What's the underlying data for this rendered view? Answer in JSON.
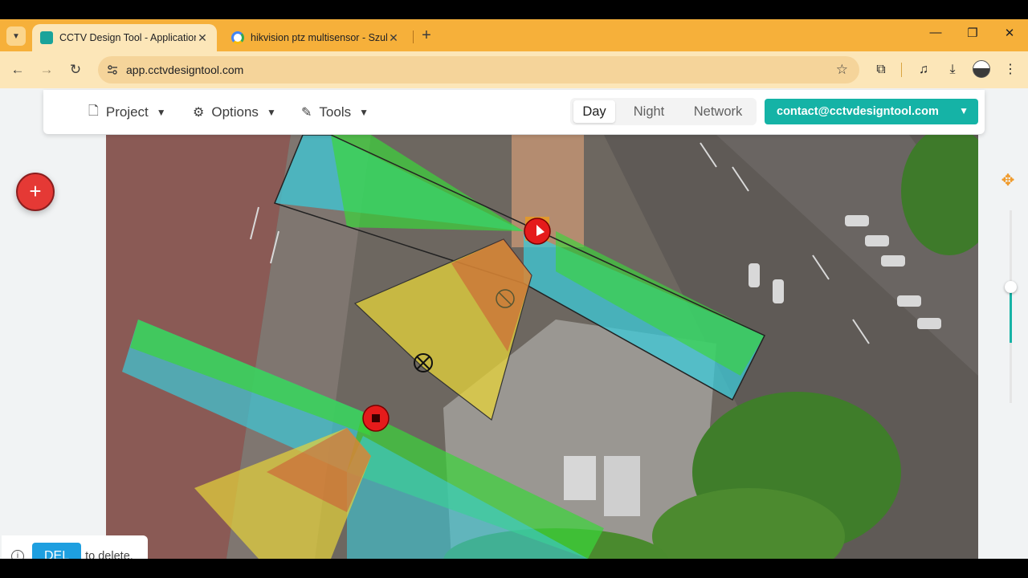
{
  "browser": {
    "tabs": [
      {
        "title": "CCTV Design Tool - Application",
        "active": true
      },
      {
        "title": "hikvision ptz multisensor - Szukaj",
        "active": false
      }
    ],
    "url": "app.cctvdesigntool.com",
    "new_tab_label": "+",
    "window_controls": {
      "minimize": "—",
      "restore": "❐",
      "close": "✕"
    }
  },
  "app": {
    "menu": {
      "project": "Project",
      "options": "Options",
      "tools": "Tools"
    },
    "view_modes": [
      "Day",
      "Night",
      "Network"
    ],
    "active_view_mode": "Day",
    "account_email": "contact@cctvdesigntool.com",
    "add_button_label": "+",
    "hint": {
      "key": "DEL",
      "text": "to delete."
    },
    "zoom_level_fraction": 0.6
  },
  "colors": {
    "browser_chrome": "#f6b03a",
    "accent": "#15b3a6",
    "add_button": "#e53935",
    "delete_key": "#1e9fe0",
    "fov_green": "#3ad63a",
    "fov_cyan": "#3cc9d8",
    "fov_yellow": "#e6d33a",
    "fov_red": "#d04030"
  },
  "icons": [
    "file-icon",
    "gear-icon",
    "pencil-icon",
    "chevron-down-icon",
    "move-icon",
    "info-icon",
    "star-icon",
    "extensions-icon",
    "media-icon",
    "download-icon",
    "menu-icon"
  ]
}
